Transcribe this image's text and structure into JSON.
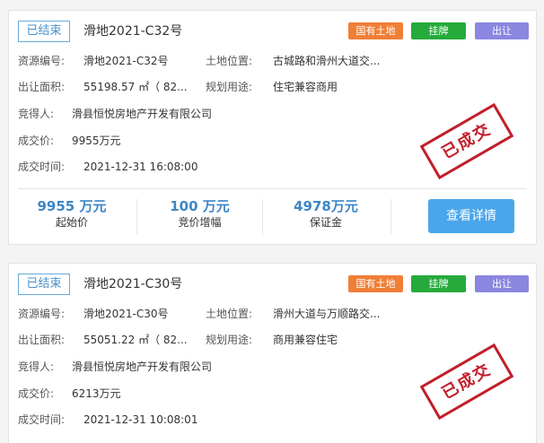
{
  "listings": [
    {
      "status": "已结束",
      "title": "滑地2021-C32号",
      "tags": {
        "land": "国有土地",
        "list": "挂牌",
        "sell": "出让"
      },
      "resource_no_label": "资源编号:",
      "resource_no": "滑地2021-C32号",
      "location_label": "土地位置:",
      "location": "古城路和滑州大道交...",
      "area_label": "出让面积:",
      "area": "55198.57 ㎡（ 82...",
      "usage_label": "规划用途:",
      "usage": "住宅兼容商用",
      "winner_label": "竞得人:",
      "winner": "滑县恒悦房地产开发有限公司",
      "price_label": "成交价:",
      "price": "9955万元",
      "time_label": "成交时间:",
      "time": "2021-12-31 16:08:00",
      "stamp": "已成交",
      "stats": [
        {
          "value": "9955 万元",
          "label": "起始价"
        },
        {
          "value": "100 万元",
          "label": "竞价增幅"
        },
        {
          "value": "4978万元",
          "label": "保证金"
        }
      ],
      "detail_button": "查看详情"
    },
    {
      "status": "已结束",
      "title": "滑地2021-C30号",
      "tags": {
        "land": "国有土地",
        "list": "挂牌",
        "sell": "出让"
      },
      "resource_no_label": "资源编号:",
      "resource_no": "滑地2021-C30号",
      "location_label": "土地位置:",
      "location": "滑州大道与万顺路交...",
      "area_label": "出让面积:",
      "area": "55051.22 ㎡（ 82...",
      "usage_label": "规划用途:",
      "usage": "商用兼容住宅",
      "winner_label": "竞得人:",
      "winner": "滑县恒悦房地产开发有限公司",
      "price_label": "成交价:",
      "price": "6213万元",
      "time_label": "成交时间:",
      "time": "2021-12-31 10:08:01",
      "stamp": "已成交"
    }
  ],
  "colors": {
    "status_border": "#69a9d9",
    "tag_land": "#f07f36",
    "tag_list": "#26aa3c",
    "tag_sell": "#8b86e0",
    "stamp": "#c21e2b",
    "stat_number": "#3d86c6",
    "button": "#4aa6ea"
  }
}
